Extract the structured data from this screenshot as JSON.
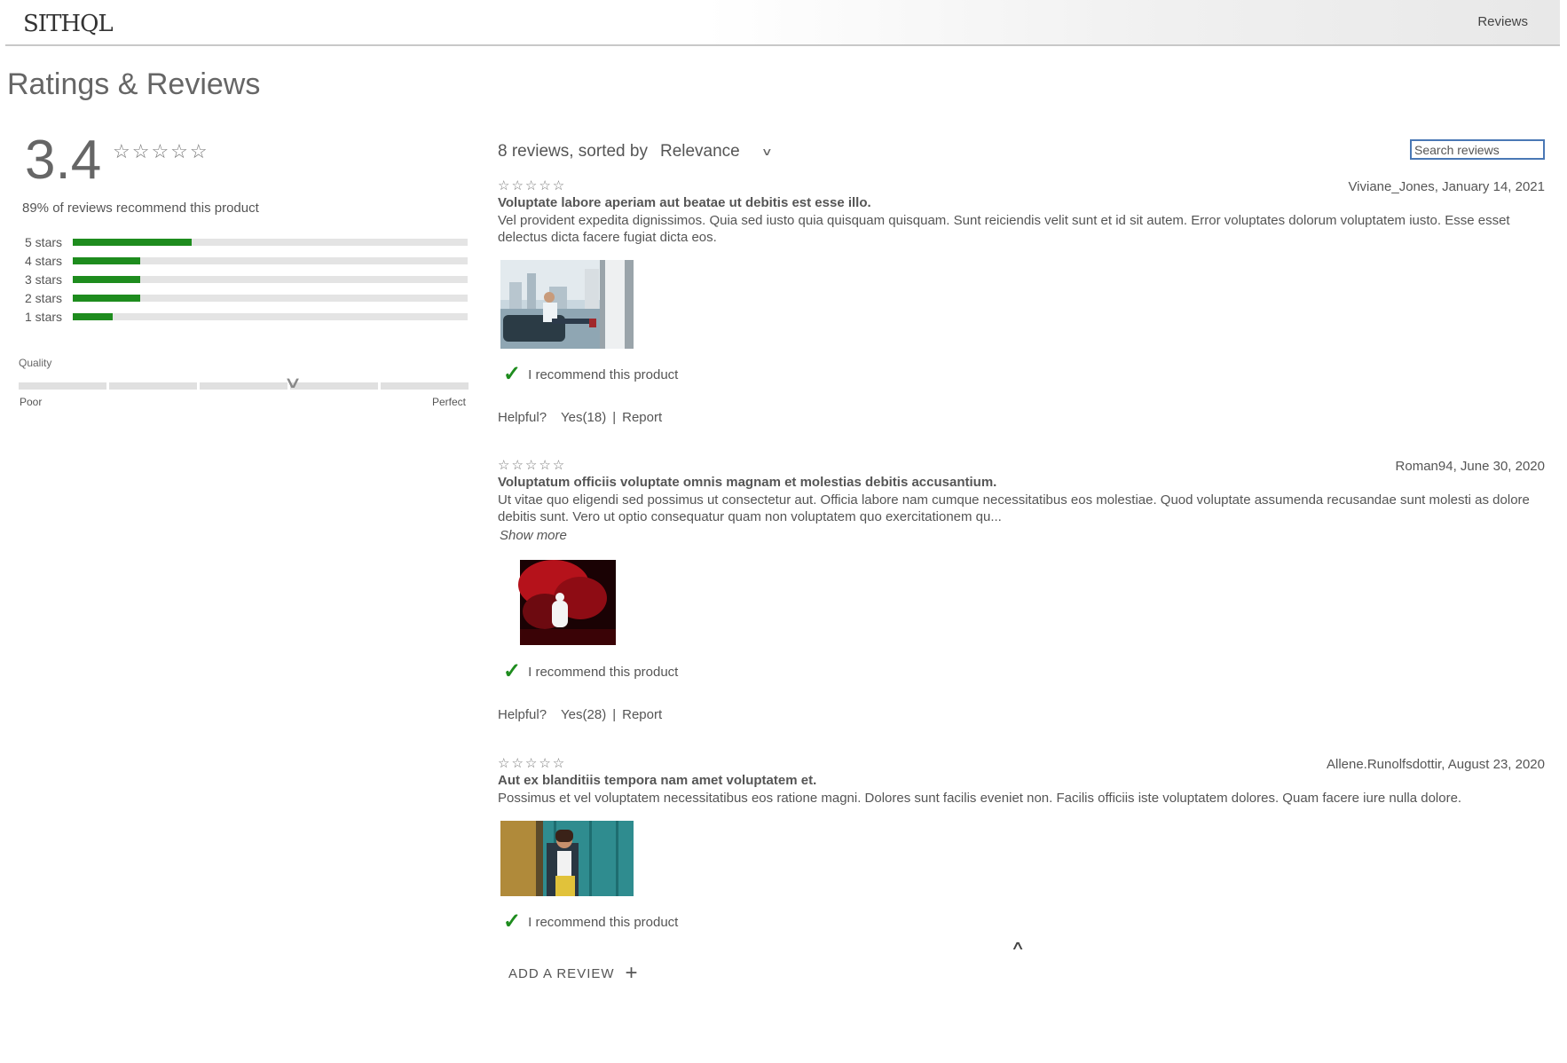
{
  "header": {
    "logo": "SITHQL",
    "nav_link": "Reviews"
  },
  "page_title": "Ratings & Reviews",
  "summary": {
    "average": "3.4",
    "average_stars": "☆☆☆☆☆",
    "recommend_text": "89% of reviews recommend this product",
    "breakdown": [
      {
        "label": "5 stars",
        "fraction": 0.3
      },
      {
        "label": "4 stars",
        "fraction": 0.17
      },
      {
        "label": "3 stars",
        "fraction": 0.17
      },
      {
        "label": "2 stars",
        "fraction": 0.17
      },
      {
        "label": "1 stars",
        "fraction": 0.1
      }
    ],
    "characteristic": {
      "name": "Quality",
      "low": "Poor",
      "high": "Perfect",
      "position": 0.61
    }
  },
  "list": {
    "count_text": "8 reviews, sorted by",
    "sort_value": "Relevance",
    "search_placeholder": "Search reviews"
  },
  "reviews": [
    {
      "stars": "☆☆☆☆☆",
      "author_date": "Viviane_Jones, January 14, 2021",
      "summary": "Voluptate labore aperiam aut beatae ut debitis est esse illo.",
      "body": "Vel provident expedita dignissimos. Quia sed iusto quia quisquam quisquam. Sunt reiciendis velit sunt et id sit autem. Error voluptates dolorum voluptatem iusto. Esse esset delectus dicta facere fugiat dicta eos.",
      "recommend": "I recommend this product",
      "helpful_label": "Helpful?",
      "helpful_yes": "Yes(18)",
      "separator": "|",
      "report": "Report"
    },
    {
      "stars": "☆☆☆☆☆",
      "author_date": "Roman94, June 30, 2020",
      "summary": "Voluptatum officiis voluptate omnis magnam et molestias debitis accusantium.",
      "body": "Ut vitae quo eligendi sed possimus ut consectetur aut. Officia labore nam cumque necessitatibus eos molestiae. Quod voluptate assumenda recusandae sunt molesti as dolore debitis sunt. Vero ut optio consequatur quam non voluptatem quo exercitationem qu...",
      "show_more": "Show more",
      "recommend": "I recommend this product",
      "helpful_label": "Helpful?",
      "helpful_yes": "Yes(28)",
      "separator": "|",
      "report": "Report"
    },
    {
      "stars": "☆☆☆☆☆",
      "author_date": "Allene.Runolfsdottir, August 23, 2020",
      "summary": "Aut ex blanditiis tempora nam amet voluptatem et.",
      "body": "Possimus et vel voluptatem necessitatibus eos ratione magni. Dolores sunt facilis eveniet non. Facilis officiis iste voluptatem dolores. Quam facere iure nulla dolore.",
      "recommend": "I recommend this product"
    }
  ],
  "add_review": "ADD A REVIEW",
  "icons": {
    "chevron_down": "chevron-down-icon",
    "check": "check-icon",
    "chevron_up": "chevron-up-icon",
    "plus": "plus-icon",
    "star": "star-outline-icon"
  },
  "colors": {
    "bar_fill": "#1e8c1e",
    "bar_track": "#e4e4e4",
    "search_border": "#4a78b5",
    "check": "#1e8c1e"
  }
}
